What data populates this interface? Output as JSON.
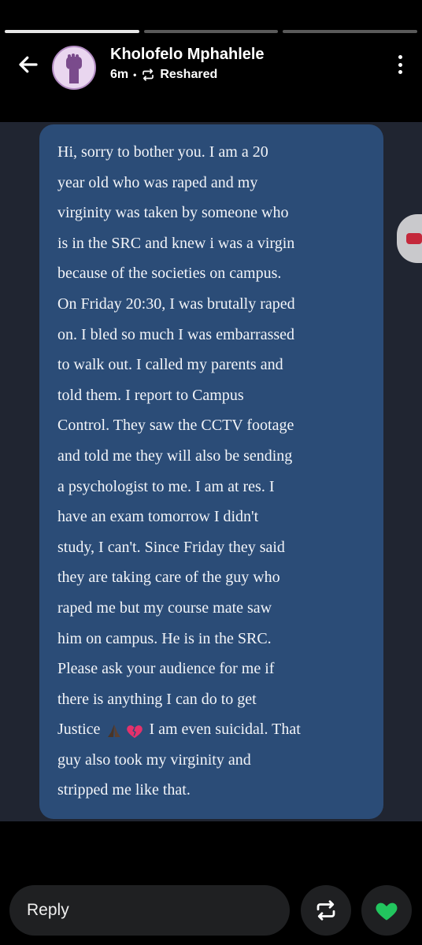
{
  "story": {
    "progress": [
      1,
      0,
      0
    ]
  },
  "header": {
    "name": "Kholofelo Mphahlele",
    "time": "6m",
    "separator": "•",
    "status": "Reshared",
    "back_icon": "arrow-left-icon",
    "menu_icon": "more-vertical-icon"
  },
  "message": {
    "lines": [
      "Hi, sorry to bother you. I am a 20",
      "year old who was raped and my",
      "virginity was taken by someone who",
      "is in the SRC and knew i was a virgin",
      "because of the societies on campus.",
      "On Friday 20:30, I was brutally raped",
      "on. I bled so much I was embarrassed",
      "to walk out. I called my parents and",
      "told them. I report to Campus",
      "Control. They saw the CCTV footage",
      "and told me they will also be sending",
      "a psychologist to me. I am at res. I",
      "have an exam tomorrow I didn't",
      "study, I can't. Since Friday they said",
      "they are taking care of the guy who",
      "raped me but my course mate saw",
      "him on campus. He is in the SRC.",
      "Please ask your audience for me if",
      "there is anything I can do to get"
    ],
    "justice_prefix": "Justice",
    "justice_suffix": "I am even suicidal. That",
    "tail_lines": [
      "guy also took my virginity and",
      "stripped me like that."
    ],
    "emojis": [
      "praying-hands-icon",
      "broken-heart-icon"
    ]
  },
  "footer": {
    "reply_label": "Reply",
    "reshare_icon": "reshare-icon",
    "like_icon": "heart-icon",
    "like_color": "#22c55e"
  }
}
